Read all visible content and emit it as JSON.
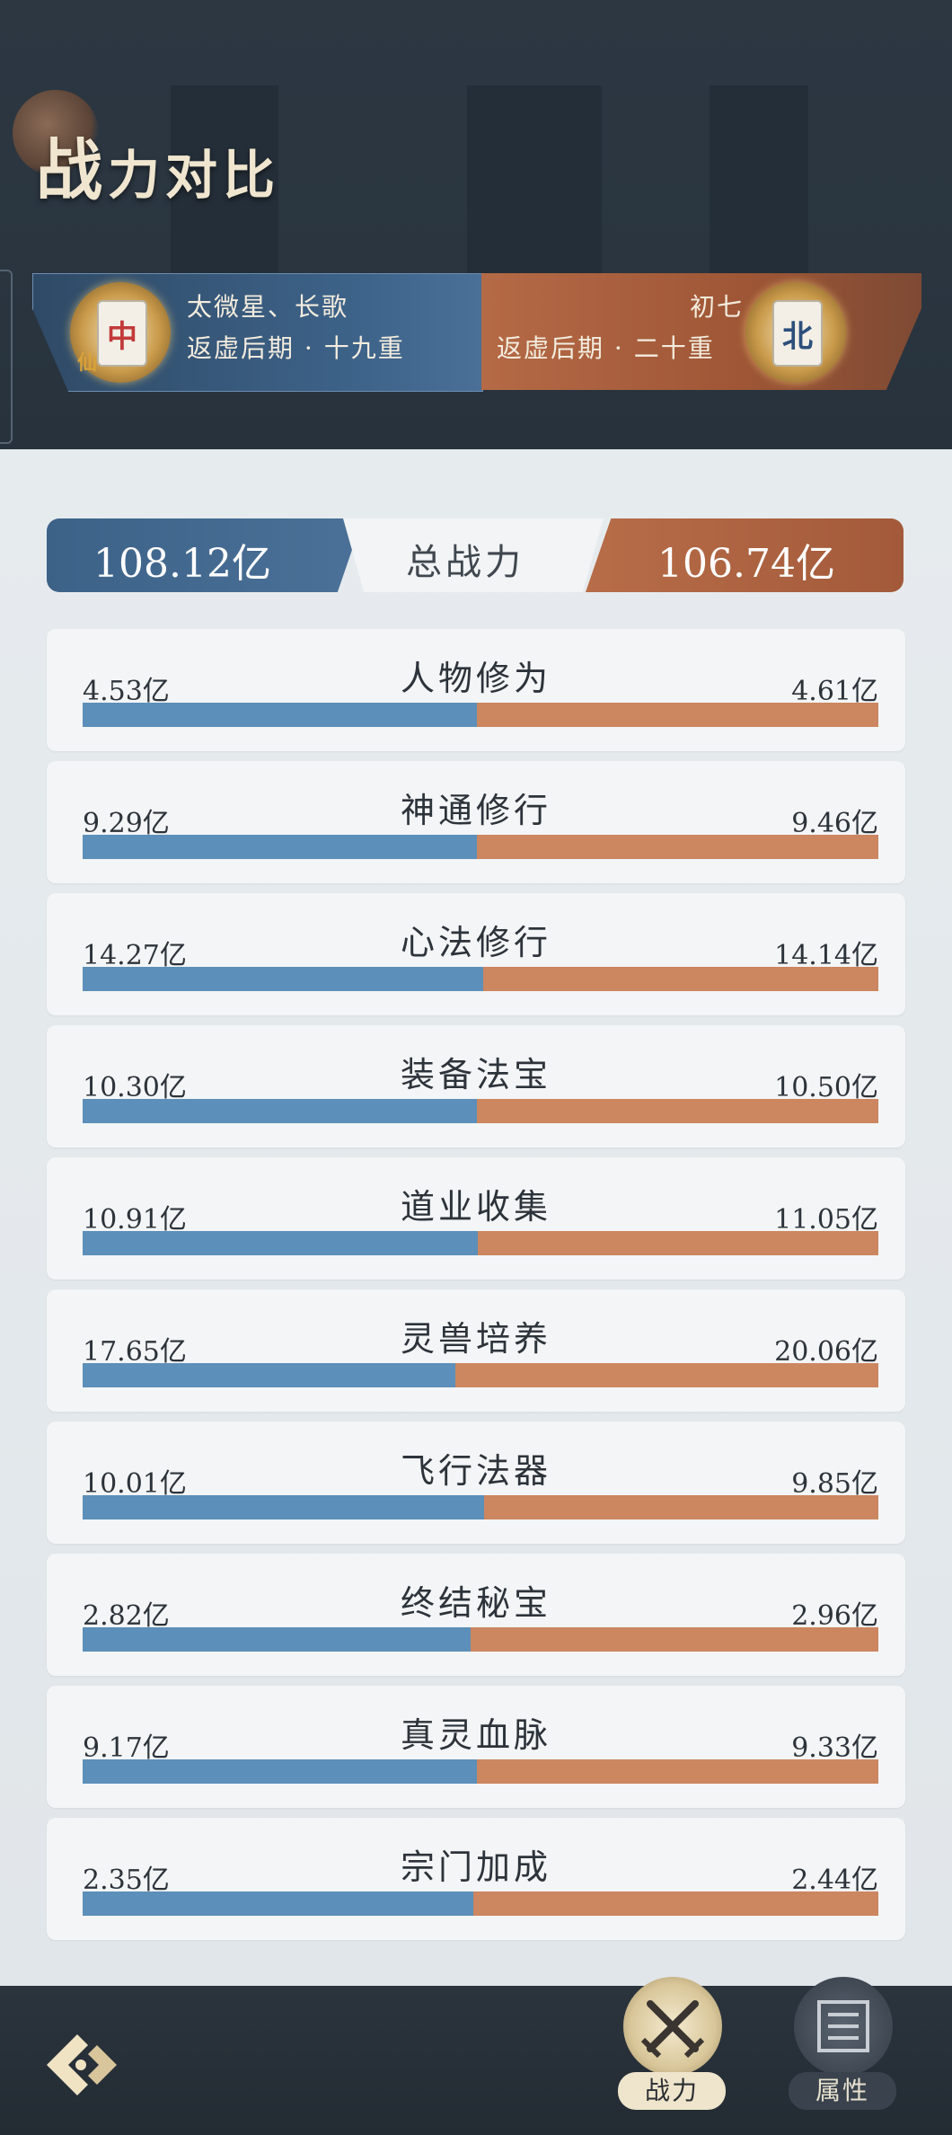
{
  "header": {
    "title_big": "战",
    "title_rest": "力对比"
  },
  "left_player": {
    "name": "太微星、长歌",
    "realm": "返虚后期 · 十九重",
    "emblem_char": "中",
    "emblem_sub": "仙"
  },
  "right_player": {
    "name": "初七",
    "realm": "返虚后期 · 二十重",
    "emblem_char": "北"
  },
  "total": {
    "label": "总战力",
    "left": "108.12亿",
    "right": "106.74亿"
  },
  "rows": [
    {
      "label": "人物修为",
      "left": "4.53亿",
      "right": "4.61亿",
      "left_share": 0.496
    },
    {
      "label": "神通修行",
      "left": "9.29亿",
      "right": "9.46亿",
      "left_share": 0.496
    },
    {
      "label": "心法修行",
      "left": "14.27亿",
      "right": "14.14亿",
      "left_share": 0.503
    },
    {
      "label": "装备法宝",
      "left": "10.30亿",
      "right": "10.50亿",
      "left_share": 0.495
    },
    {
      "label": "道业收集",
      "left": "10.91亿",
      "right": "11.05亿",
      "left_share": 0.497
    },
    {
      "label": "灵兽培养",
      "left": "17.65亿",
      "right": "20.06亿",
      "left_share": 0.468
    },
    {
      "label": "飞行法器",
      "left": "10.01亿",
      "right": "9.85亿",
      "left_share": 0.504
    },
    {
      "label": "终结秘宝",
      "left": "2.82亿",
      "right": "2.96亿",
      "left_share": 0.488
    },
    {
      "label": "真灵血脉",
      "left": "9.17亿",
      "right": "9.33亿",
      "left_share": 0.496
    },
    {
      "label": "宗门加成",
      "left": "2.35亿",
      "right": "2.44亿",
      "left_share": 0.491
    }
  ],
  "nav": {
    "power_label": "战力",
    "attr_label": "属性"
  },
  "colors": {
    "left_accent": "#5c8fb9",
    "right_accent": "#cc8660"
  }
}
